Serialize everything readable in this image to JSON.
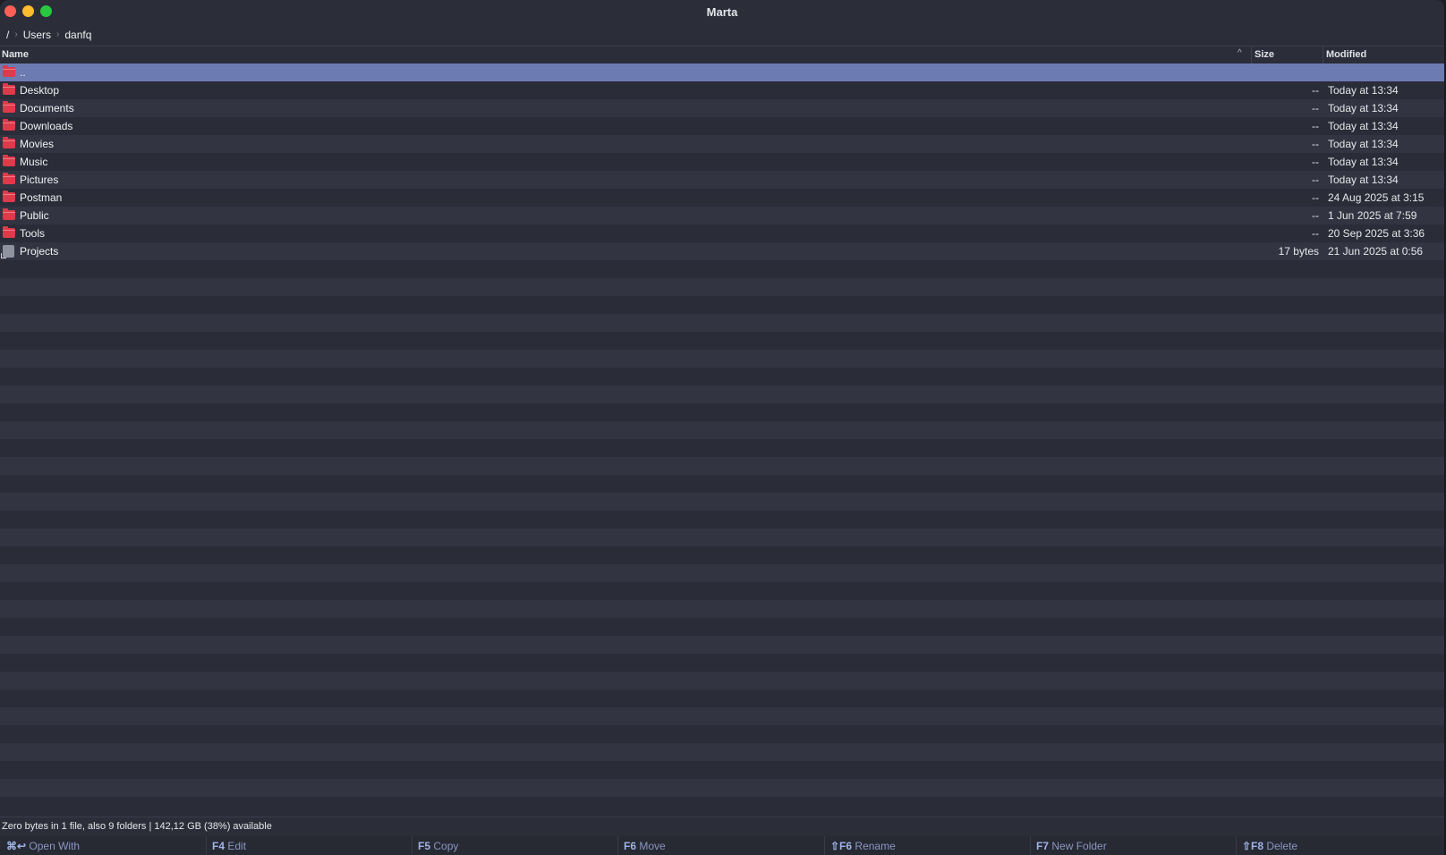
{
  "window": {
    "title": "Marta"
  },
  "breadcrumb": {
    "root": "/",
    "items": [
      "Users",
      "danfq"
    ]
  },
  "columns": {
    "name": "Name",
    "sort_indicator": "^",
    "size": "Size",
    "modified": "Modified"
  },
  "files": [
    {
      "name": "..",
      "size": "",
      "modified": "",
      "icon": "folder-icon",
      "selected": true
    },
    {
      "name": "Desktop",
      "size": "--",
      "modified": "Today at 13:34",
      "icon": "folder-icon"
    },
    {
      "name": "Documents",
      "size": "--",
      "modified": "Today at 13:34",
      "icon": "folder-icon"
    },
    {
      "name": "Downloads",
      "size": "--",
      "modified": "Today at 13:34",
      "icon": "folder-icon"
    },
    {
      "name": "Movies",
      "size": "--",
      "modified": "Today at 13:34",
      "icon": "folder-icon"
    },
    {
      "name": "Music",
      "size": "--",
      "modified": "Today at 13:34",
      "icon": "folder-icon"
    },
    {
      "name": "Pictures",
      "size": "--",
      "modified": "Today at 13:34",
      "icon": "folder-icon"
    },
    {
      "name": "Postman",
      "size": "--",
      "modified": "24 Aug 2025 at 3:15",
      "icon": "folder-icon"
    },
    {
      "name": "Public",
      "size": "--",
      "modified": "1 Jun 2025 at 7:59",
      "icon": "folder-icon"
    },
    {
      "name": "Tools",
      "size": "--",
      "modified": "20 Sep 2025 at 3:36",
      "icon": "folder-icon"
    },
    {
      "name": "Projects",
      "size": "17 bytes",
      "modified": "21 Jun 2025 at 0:56",
      "icon": "alias-file-icon"
    }
  ],
  "status": {
    "text": "Zero bytes in 1 file, also 9 folders  |  142,12 GB (38%) available"
  },
  "function_keys": [
    {
      "key": "⌘↩",
      "label": "Open With"
    },
    {
      "key": "F4",
      "label": "Edit"
    },
    {
      "key": "F5",
      "label": "Copy"
    },
    {
      "key": "F6",
      "label": "Move"
    },
    {
      "key": "⇧F6",
      "label": "Rename"
    },
    {
      "key": "F7",
      "label": "New Folder"
    },
    {
      "key": "⇧F8",
      "label": "Delete"
    }
  ],
  "colors": {
    "selection": "#6c7bb2",
    "folder": "#e0394a",
    "row_odd": "#323442",
    "row_even": "#2a2c38",
    "fkey_text": "#9fb4e6"
  }
}
